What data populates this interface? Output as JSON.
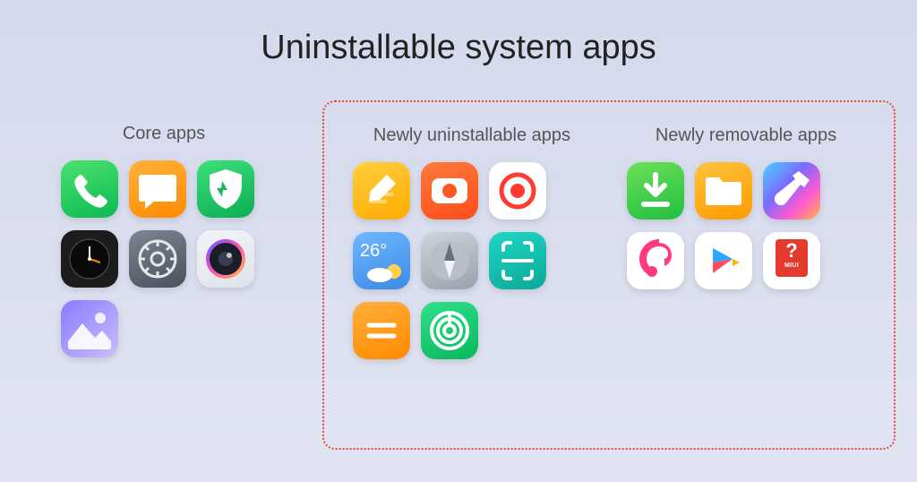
{
  "title": "Uninstallable system apps",
  "sections": {
    "core": {
      "label": "Core apps",
      "apps": [
        "phone",
        "messages",
        "security",
        "clock",
        "settings",
        "camera",
        "gallery"
      ]
    },
    "newly_uninstallable": {
      "label": "Newly uninstallable apps",
      "apps": [
        "notes",
        "recorder",
        "screen-recorder",
        "weather",
        "compass",
        "scanner",
        "calculator",
        "share"
      ]
    },
    "newly_removable": {
      "label": "Newly removable apps",
      "apps": [
        "downloads",
        "file-manager",
        "themes",
        "music",
        "video",
        "feedback"
      ]
    }
  },
  "weather_value": "26°",
  "feedback_label": "MIUI"
}
